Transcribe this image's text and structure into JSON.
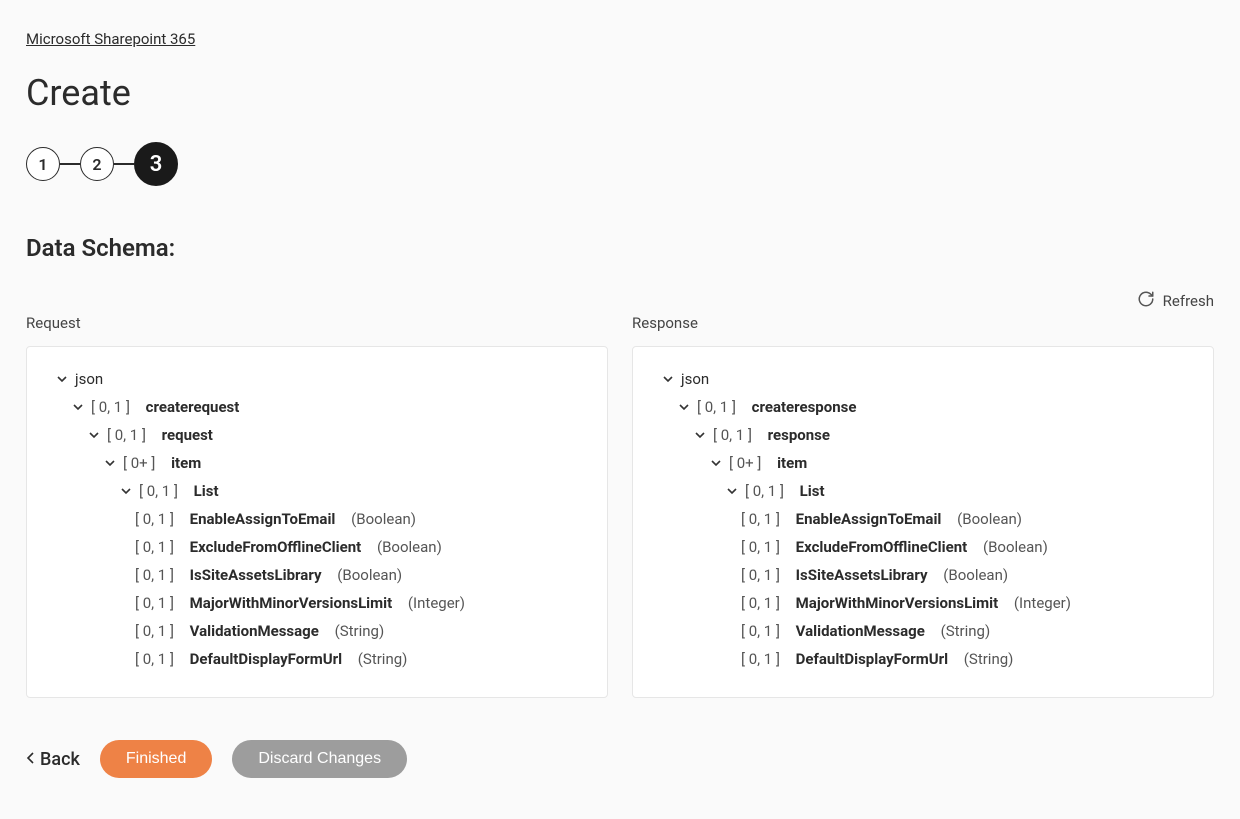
{
  "breadcrumb": "Microsoft Sharepoint 365",
  "page_title": "Create",
  "stepper": {
    "steps": [
      "1",
      "2",
      "3"
    ],
    "active_index": 2
  },
  "section_title": "Data Schema:",
  "refresh_label": "Refresh",
  "columns": {
    "request": {
      "label": "Request",
      "root": "json",
      "tree": [
        {
          "card": "[ 0, 1 ]",
          "name": "createrequest"
        },
        {
          "card": "[ 0, 1 ]",
          "name": "request"
        },
        {
          "card": "[ 0+ ]",
          "name": "item"
        },
        {
          "card": "[ 0, 1 ]",
          "name": "List"
        }
      ],
      "leaves": [
        {
          "card": "[ 0, 1 ]",
          "name": "EnableAssignToEmail",
          "type": "(Boolean)"
        },
        {
          "card": "[ 0, 1 ]",
          "name": "ExcludeFromOfflineClient",
          "type": "(Boolean)"
        },
        {
          "card": "[ 0, 1 ]",
          "name": "IsSiteAssetsLibrary",
          "type": "(Boolean)"
        },
        {
          "card": "[ 0, 1 ]",
          "name": "MajorWithMinorVersionsLimit",
          "type": "(Integer)"
        },
        {
          "card": "[ 0, 1 ]",
          "name": "ValidationMessage",
          "type": "(String)"
        },
        {
          "card": "[ 0, 1 ]",
          "name": "DefaultDisplayFormUrl",
          "type": "(String)"
        }
      ]
    },
    "response": {
      "label": "Response",
      "root": "json",
      "tree": [
        {
          "card": "[ 0, 1 ]",
          "name": "createresponse"
        },
        {
          "card": "[ 0, 1 ]",
          "name": "response"
        },
        {
          "card": "[ 0+ ]",
          "name": "item"
        },
        {
          "card": "[ 0, 1 ]",
          "name": "List"
        }
      ],
      "leaves": [
        {
          "card": "[ 0, 1 ]",
          "name": "EnableAssignToEmail",
          "type": "(Boolean)"
        },
        {
          "card": "[ 0, 1 ]",
          "name": "ExcludeFromOfflineClient",
          "type": "(Boolean)"
        },
        {
          "card": "[ 0, 1 ]",
          "name": "IsSiteAssetsLibrary",
          "type": "(Boolean)"
        },
        {
          "card": "[ 0, 1 ]",
          "name": "MajorWithMinorVersionsLimit",
          "type": "(Integer)"
        },
        {
          "card": "[ 0, 1 ]",
          "name": "ValidationMessage",
          "type": "(String)"
        },
        {
          "card": "[ 0, 1 ]",
          "name": "DefaultDisplayFormUrl",
          "type": "(String)"
        }
      ]
    }
  },
  "footer": {
    "back": "Back",
    "finished": "Finished",
    "discard": "Discard Changes"
  }
}
